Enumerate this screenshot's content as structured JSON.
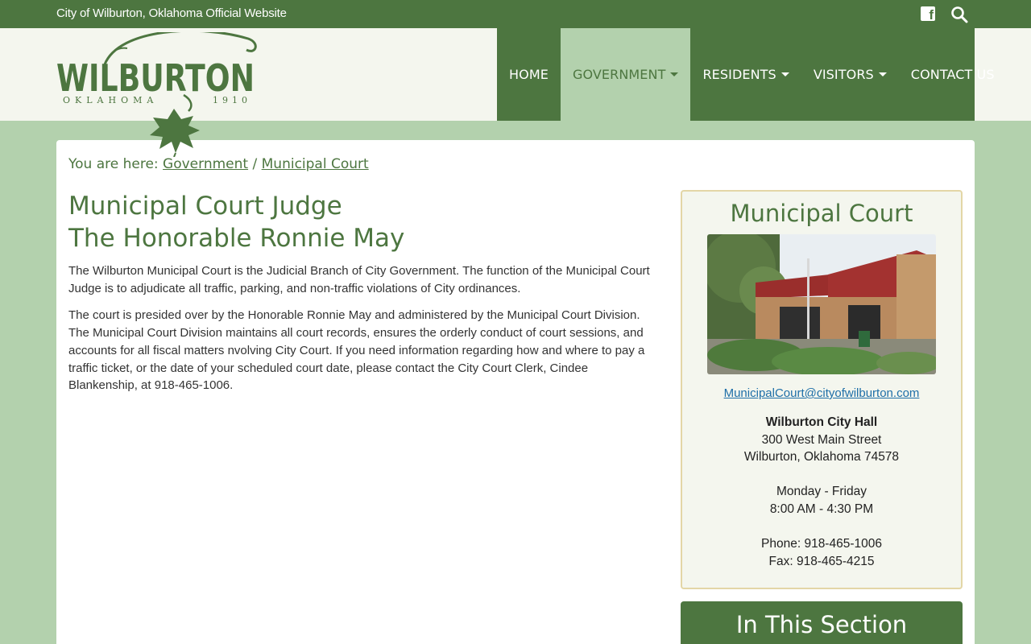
{
  "topbar": {
    "site_title": "City of Wilburton, Oklahoma Official Website",
    "facebook_icon": "facebook-icon",
    "search_icon": "search-icon"
  },
  "logo": {
    "name": "WILBURTON",
    "state": "OKLAHOMA",
    "year": "1910"
  },
  "nav": {
    "items": [
      {
        "label": "HOME",
        "active": false,
        "dropdown": false
      },
      {
        "label": "GOVERNMENT",
        "active": true,
        "dropdown": true
      },
      {
        "label": "RESIDENTS",
        "active": false,
        "dropdown": true
      },
      {
        "label": "VISITORS",
        "active": false,
        "dropdown": true
      },
      {
        "label": "CONTACT US",
        "active": false,
        "dropdown": false
      }
    ]
  },
  "breadcrumb": {
    "prefix": "You are here:",
    "links": [
      "Government",
      "Municipal Court"
    ],
    "separator": "/"
  },
  "main": {
    "title_line1": "Municipal Court Judge",
    "title_line2": "The Honorable Ronnie May",
    "paragraphs": [
      "The Wilburton Municipal Court is the Judicial Branch of City Government. The function of the Municipal Court Judge is to adjudicate all traffic, parking, and non-traffic violations of City ordinances.",
      "The court is presided over by the Honorable Ronnie May and administered by the Municipal Court Division.  The Municipal Court Division maintains all court records, ensures the orderly conduct of court sessions, and accounts for all fiscal matters nvolving City Court.  If you need information regarding how and where to pay a traffic ticket, or the date of your scheduled court date, please contact the City Court Clerk, Cindee Blankenship, at 918-465-1006."
    ]
  },
  "sidebar": {
    "card_title": "Municipal Court",
    "email": "MunicipalCourt@cityofwilburton.com",
    "location_name": "Wilburton City Hall",
    "address_line1": "300 West Main Street",
    "address_line2": "Wilburton, Oklahoma 74578",
    "hours_days": "Monday - Friday",
    "hours_time": "8:00 AM - 4:30 PM",
    "phone": "Phone: 918-465-1006",
    "fax": "Fax: 918-465-4215"
  },
  "section_box": {
    "title": "In This Section"
  },
  "colors": {
    "primary_green": "#4d7640",
    "light_green": "#b3d1ad",
    "cream": "#f4f6ee",
    "card_border": "#e3d6a6",
    "link_blue": "#1f6fa8"
  }
}
